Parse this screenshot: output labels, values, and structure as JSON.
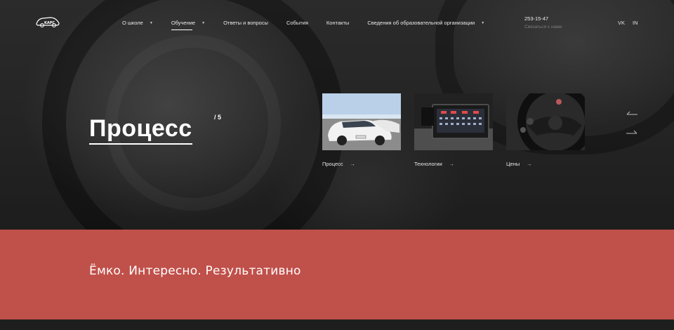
{
  "header": {
    "logo_icon": "car-logo-icon",
    "nav": [
      {
        "label": "О школе",
        "dropdown": true,
        "active": false
      },
      {
        "label": "Обучение",
        "dropdown": true,
        "active": true
      },
      {
        "label": "Ответы и вопросы",
        "dropdown": false,
        "active": false
      },
      {
        "label": "События",
        "dropdown": false,
        "active": false
      },
      {
        "label": "Контакты",
        "dropdown": false,
        "active": false
      },
      {
        "label": "Сведения об образовательной организации",
        "dropdown": true,
        "active": false
      }
    ],
    "phone": "253-15-47",
    "contact_link": "Связаться с нами",
    "lang": [
      "VK",
      "IN"
    ]
  },
  "hero": {
    "title": "Процесс",
    "counter": "/ 5",
    "cards": [
      {
        "label": "Процесс",
        "image_icon": "car-photo",
        "arrow": "→"
      },
      {
        "label": "Технологии",
        "image_icon": "dashboard-photo",
        "arrow": "→"
      },
      {
        "label": "Цены",
        "image_icon": "steering-wheel-photo",
        "arrow": "→"
      }
    ],
    "prev_icon": "arrow-left-icon",
    "next_icon": "arrow-right-icon"
  },
  "band": {
    "text": "Ёмко. Интересно. Результативно"
  },
  "colors": {
    "band": "#c0504a",
    "dark": "#1f1f1f"
  }
}
